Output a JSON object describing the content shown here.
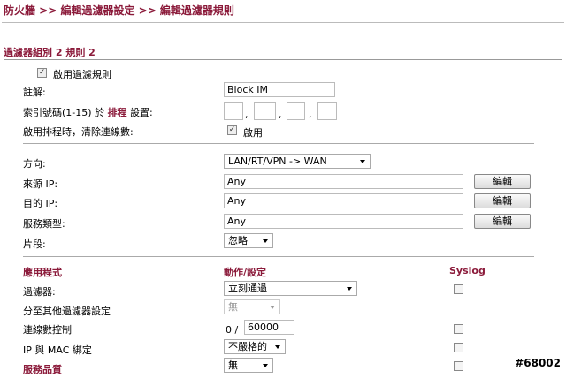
{
  "breadcrumb": "防火牆 >> 編輯過濾器設定 >> 編輯過濾器規則",
  "section_title": "過濾器組別 2 規則 2",
  "enable_rule_label": "啟用過濾規則",
  "comment": {
    "label": "註解:",
    "value": "Block IM"
  },
  "schedule": {
    "label_pre": "索引號碼(1-15) 於",
    "link": "排程",
    "label_post": "設置:"
  },
  "clear_sessions": {
    "label": "啟用排程時，清除連線數:",
    "checkbox_label": "啟用"
  },
  "direction": {
    "label": "方向:",
    "value": "LAN/RT/VPN -> WAN"
  },
  "source_ip": {
    "label": "來源 IP:",
    "value": "Any",
    "button": "編輯"
  },
  "dest_ip": {
    "label": "目的 IP:",
    "value": "Any",
    "button": "編輯"
  },
  "service_type": {
    "label": "服務類型:",
    "value": "Any",
    "button": "編輯"
  },
  "fragment": {
    "label": "片段:",
    "value": "忽略"
  },
  "table_headers": {
    "app": "應用程式",
    "action": "動作/設定",
    "syslog": "Syslog"
  },
  "rows": {
    "filter": {
      "label": "過濾器:",
      "value": "立刻通過"
    },
    "branch": {
      "label": "分至其他過濾器設定",
      "value": "無"
    },
    "session_control": {
      "label": "連線數控制",
      "prefix": "0 /",
      "value": "60000"
    },
    "ip_mac": {
      "label": "IP 與 MAC 綁定",
      "value": "不嚴格的"
    },
    "qos": {
      "label": "服務品質",
      "value": "無"
    }
  },
  "watermark": "#68002",
  "checkmark": "☑"
}
